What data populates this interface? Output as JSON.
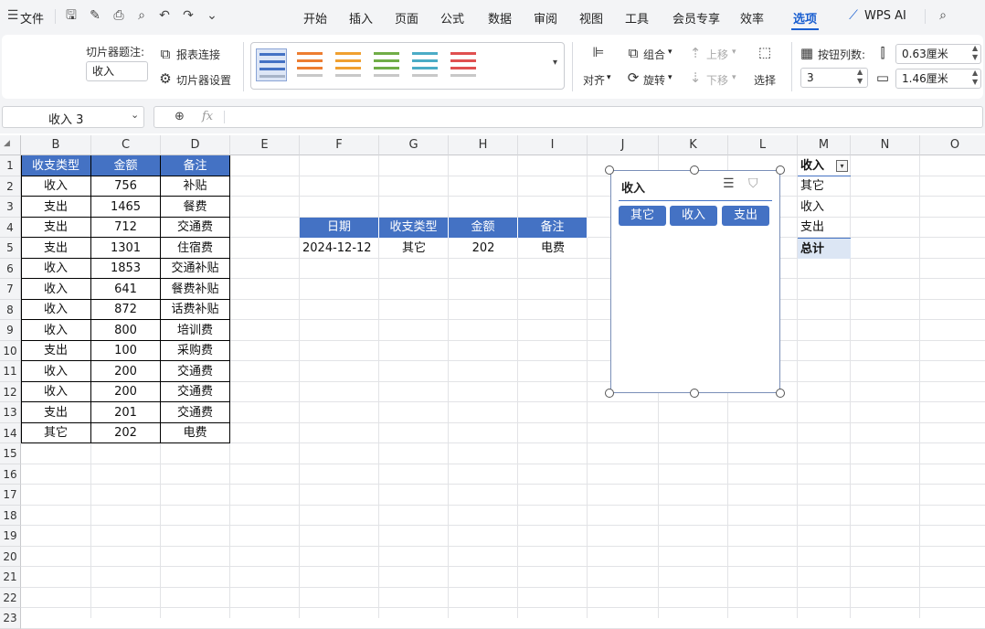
{
  "menubar": {
    "file_label": "文件",
    "tabs": [
      "开始",
      "插入",
      "页面",
      "公式",
      "数据",
      "审阅",
      "视图",
      "工具",
      "会员专享",
      "效率",
      "选项"
    ],
    "active_tab": "选项",
    "wps_ai_label": "WPS AI"
  },
  "ribbon": {
    "caption_label": "切片器题注:",
    "caption_value": "收入",
    "report_link_label": "报表连接",
    "slicer_settings_label": "切片器设置",
    "align_label": "对齐",
    "group_label": "组合",
    "rotate_label": "旋转",
    "up_label": "上移",
    "down_label": "下移",
    "select_label": "选择",
    "button_columns_label": "按钮列数:",
    "button_columns_value": "3",
    "height_value": "0.63厘米",
    "width_value": "1.46厘米",
    "style_colors": [
      "#4472c4",
      "#ed7d31",
      "#f0a030",
      "#70ad47",
      "#4bacc6",
      "#e05050"
    ]
  },
  "formulabar": {
    "name_box": "收入 3",
    "fx": "fx"
  },
  "grid": {
    "columns": [
      "B",
      "C",
      "D",
      "E",
      "F",
      "G",
      "H",
      "I",
      "J",
      "K",
      "L",
      "M",
      "N",
      "O"
    ],
    "rows": [
      "1",
      "2",
      "3",
      "4",
      "5",
      "6",
      "7",
      "8",
      "9",
      "10",
      "11",
      "12",
      "13",
      "14",
      "15",
      "16",
      "17",
      "18",
      "19",
      "20",
      "21",
      "22",
      "23"
    ],
    "table1": {
      "headers": [
        "收支类型",
        "金额",
        "备注"
      ],
      "rows": [
        [
          "收入",
          "756",
          "补贴"
        ],
        [
          "支出",
          "1465",
          "餐费"
        ],
        [
          "支出",
          "712",
          "交通费"
        ],
        [
          "支出",
          "1301",
          "住宿费"
        ],
        [
          "收入",
          "1853",
          "交通补贴"
        ],
        [
          "收入",
          "641",
          "餐费补贴"
        ],
        [
          "收入",
          "872",
          "话费补贴"
        ],
        [
          "收入",
          "800",
          "培训费"
        ],
        [
          "支出",
          "100",
          "采购费"
        ],
        [
          "收入",
          "200",
          "交通费"
        ],
        [
          "收入",
          "200",
          "交通费"
        ],
        [
          "支出",
          "201",
          "交通费"
        ],
        [
          "其它",
          "202",
          "电费"
        ]
      ]
    },
    "table2": {
      "headers": [
        "日期",
        "收支类型",
        "金额",
        "备注"
      ],
      "rows": [
        [
          "2024-12-12",
          "其它",
          "202",
          "电费"
        ]
      ]
    },
    "pivot": {
      "header": "收入",
      "items": [
        "其它",
        "收入",
        "支出"
      ],
      "total": "总计"
    }
  },
  "slicer": {
    "title": "收入",
    "buttons": [
      "其它",
      "收入",
      "支出"
    ]
  }
}
